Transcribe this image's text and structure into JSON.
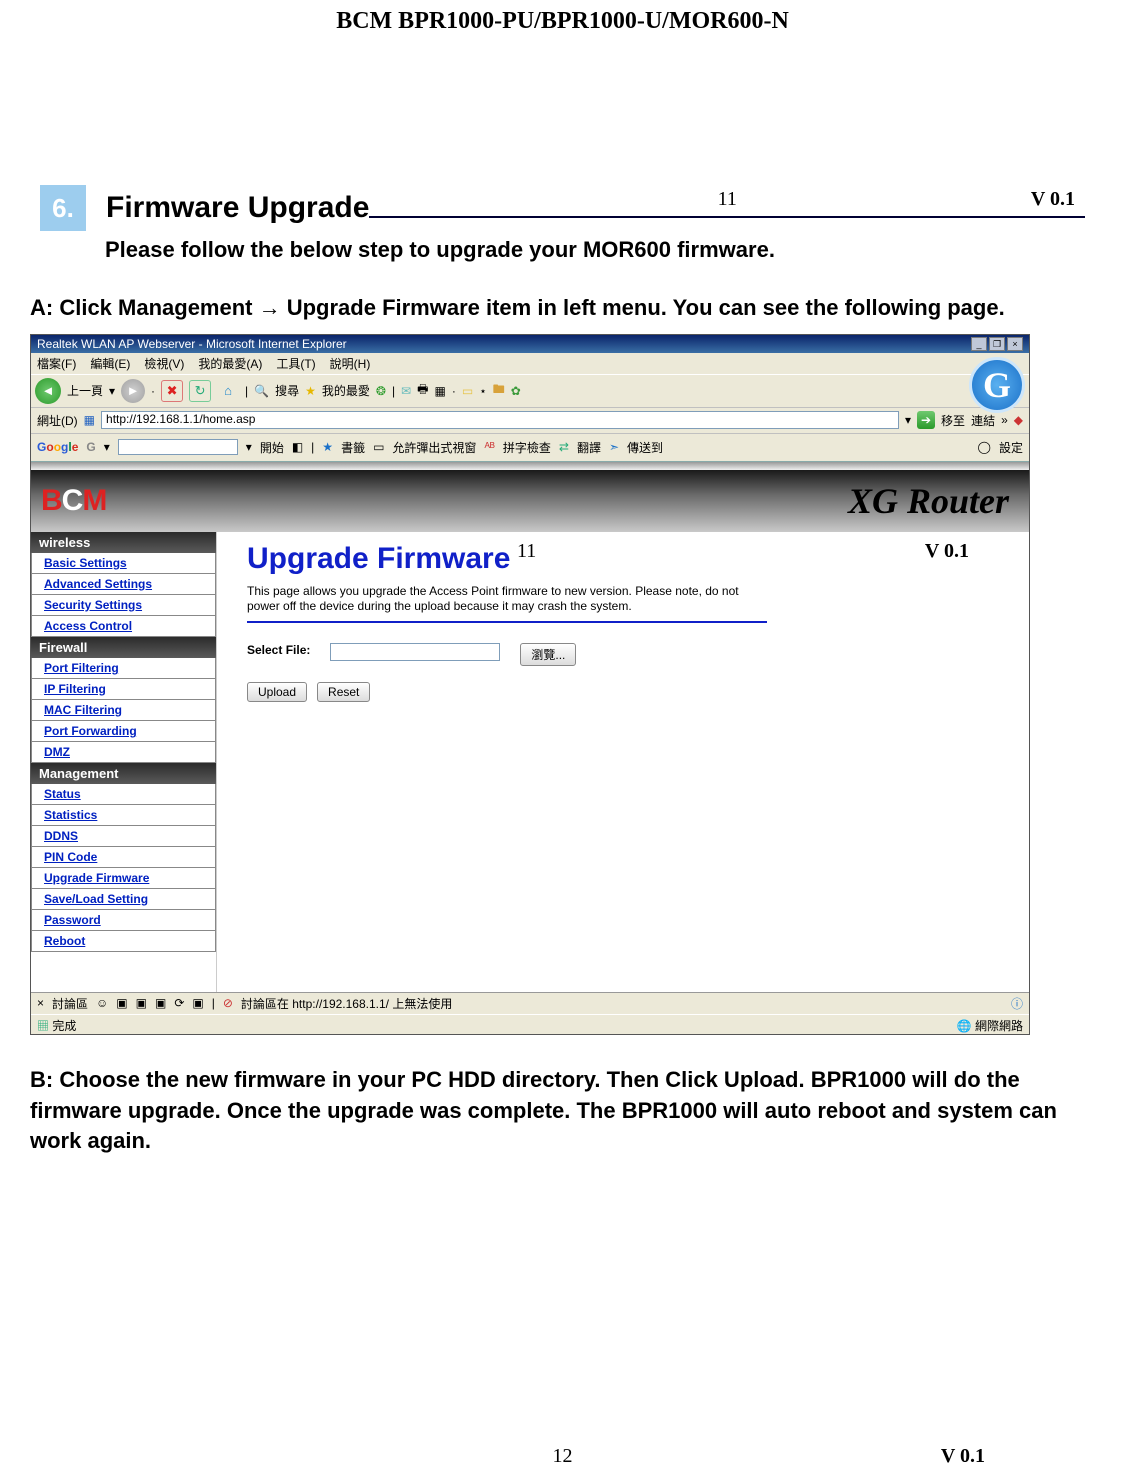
{
  "doc": {
    "header": "BCM    BPR1000-PU/BPR1000-U/MOR600-N",
    "section_num": "6.",
    "section_title": "Firmware Upgrade",
    "pg_inline": "11",
    "ver_inline": "V 0.1",
    "intro": "Please follow the below step to upgrade your MOR600 firmware.",
    "step_a": "A: Click Management → Upgrade Firmware item in left menu. You can see the following page.",
    "step_b": "B: Choose the new firmware in your PC HDD directory. Then Click Upload. BPR1000 will do the firmware upgrade. Once the upgrade was complete. The BPR1000 will auto reboot and system can work again.",
    "footer_pg": "12",
    "footer_ver": "V 0.1"
  },
  "ie": {
    "title": "Realtek WLAN AP Webserver - Microsoft Internet Explorer",
    "menu": {
      "file": "檔案(F)",
      "edit": "編輯(E)",
      "view": "檢視(V)",
      "fav": "我的最愛(A)",
      "tools": "工具(T)",
      "help": "說明(H)"
    },
    "back": "上一頁",
    "search": "搜尋",
    "favorites": "我的最愛",
    "addr_label": "網址(D)",
    "url": "http://192.168.1.1/home.asp",
    "go": "移至",
    "links": "連結",
    "google": "Google",
    "g_start": "開始",
    "g_bookmarks": "書籤",
    "g_popup": "允許彈出式視窗",
    "g_spell": "拼字檢查",
    "g_translate": "翻譯",
    "g_send": "傳送到",
    "g_settings": "設定",
    "chat_label": "討論區",
    "chat_msg": "討論區在 http://192.168.1.1/ 上無法使用",
    "status_done": "完成",
    "status_net": "網際網路"
  },
  "router": {
    "logo1": "B",
    "logo2": "C",
    "logo3": "M",
    "product": "XG Router",
    "cats": {
      "wireless": "wireless",
      "firewall": "Firewall",
      "management": "Management"
    },
    "nav": {
      "basic": "Basic Settings",
      "adv": "Advanced Settings",
      "sec": "Security Settings",
      "acl": "Access Control",
      "portf": "Port Filtering",
      "ipf": "IP Filtering",
      "macf": "MAC Filtering",
      "pfw": "Port Forwarding",
      "dmz": "DMZ",
      "status": "Status",
      "stats": "Statistics",
      "ddns": "DDNS",
      "pin": "PIN Code",
      "upg": "Upgrade Firmware",
      "save": "Save/Load Setting",
      "pwd": "Password",
      "reboot": "Reboot"
    },
    "page_title": "Upgrade Firmware",
    "overlay_num": "11",
    "overlay_ver": "V 0.1",
    "desc": "This page allows you upgrade the Access Point firmware to new version. Please note, do not power off the device during the upload because it may crash the system.",
    "select_file": "Select File:",
    "browse": "瀏覽...",
    "upload": "Upload",
    "reset": "Reset"
  }
}
